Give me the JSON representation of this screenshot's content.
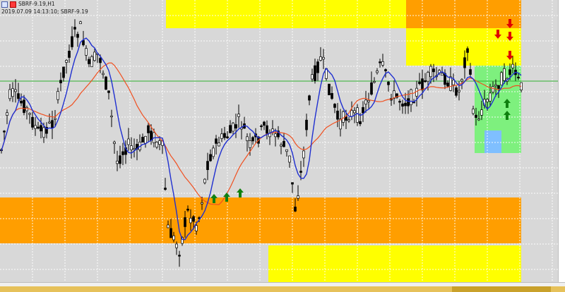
{
  "window": {
    "title": "SBRF-9.19,H1",
    "subtitle": "2019.07.09 14:13:10; SBRF-9.19"
  },
  "icons": [
    "chart-window-icon",
    "properties-icon"
  ],
  "colors": {
    "plot_bg": "#d8d8d8",
    "grid": "#ffffff",
    "candle": "#000000",
    "ma_fast": "#1f2fd0",
    "ma_slow": "#f05020",
    "level_line": "#30b030",
    "zone_orange": "#ff9e00",
    "zone_yellow": "#ffff00",
    "zone_green": "#7ef07e",
    "zone_blue": "#7fbfff",
    "arrow_up": "#108010",
    "arrow_down": "#e00000"
  },
  "chart_data": {
    "type": "candlestick",
    "candles_count": 190,
    "series": [
      "fast moving average",
      "slow moving average"
    ],
    "zones": [
      "supply (orange)",
      "supply (yellow)",
      "demand (orange)",
      "demand (yellow)",
      "demand (green)",
      "target (blue)"
    ],
    "signals": {
      "buy_arrows": 5,
      "sell_arrows": 4
    }
  }
}
